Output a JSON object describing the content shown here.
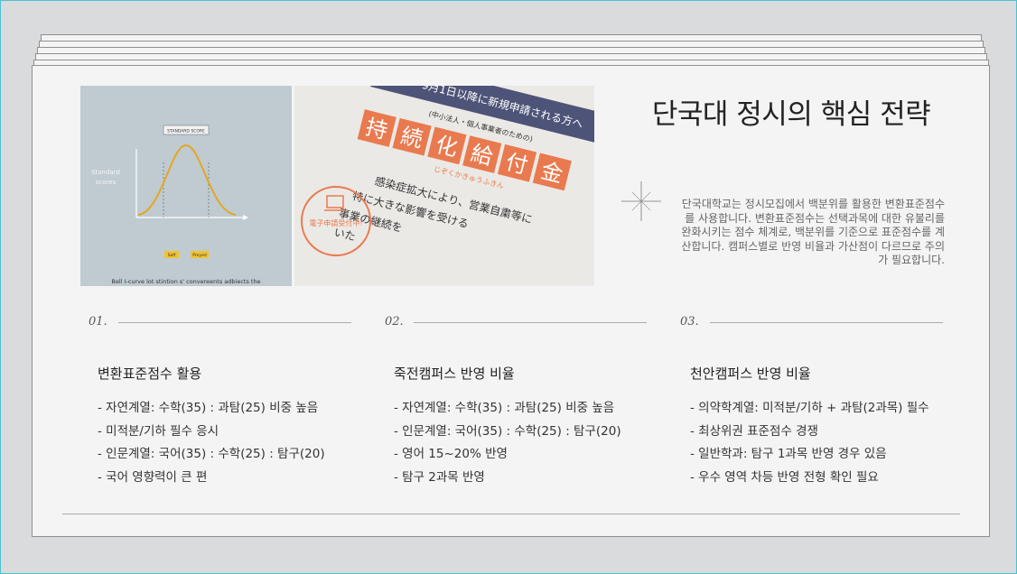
{
  "title": "단국대 정시의 핵심 전략",
  "description": "단국대학교는 정시모집에서 백분위를 활용한 변환표준점수를 사용합니다. 변환표준점수는 선택과목에 대한 유불리를 완화시키는 점수 체계로, 백분위를 기준으로 표준점수를 계산합니다. 캠퍼스별로 반영 비율과 가산점이 다르므로 주의가 필요합니다.",
  "left_image": {
    "chart_label": "STANDARD SCORE",
    "axis_label": "Standard scores",
    "button_a": "Saff",
    "button_b": "Preyed",
    "caption": "Bell I-curve lot stintion s' convereents adbiects the"
  },
  "right_image": {
    "banner": "9月1日以降に新規申請される方へ",
    "sub_banner": "(中小法人・個人事業者のための)",
    "big_text": [
      "持",
      "続",
      "化",
      "給",
      "付",
      "金"
    ],
    "reading": "じぞくかきゅうふきん",
    "stamp_text": "電子申請受付中!",
    "body_lines": [
      "感染症拡大により、営業自粛等に",
      "特に大きな影響を受ける",
      "事業の継続を",
      "いた"
    ]
  },
  "columns": [
    {
      "num": "01.",
      "heading": "변환표준점수 활용",
      "items": [
        "- 자연계열: 수학(35) : 과탐(25) 비중 높음",
        "- 미적분/기하 필수 응시",
        "- 인문계열: 국어(35) : 수학(25) : 탐구(20)",
        "- 국어 영향력이 큰 편"
      ]
    },
    {
      "num": "02.",
      "heading": "죽전캠퍼스 반영 비율",
      "items": [
        "- 자연계열: 수학(35) : 과탐(25) 비중 높음",
        "- 인문계열: 국어(35) : 수학(25) : 탐구(20)",
        "- 영어 15~20% 반영",
        "- 탐구 2과목 반영"
      ]
    },
    {
      "num": "03.",
      "heading": "천안캠퍼스 반영 비율",
      "items": [
        "- 의약학계열: 미적분/기하 + 과탐(2과목) 필수",
        "- 최상위권 표준점수 경쟁",
        "- 일반학과: 탐구 1과목 반영 경우 있음",
        "- 우수 영역 차등 반영 전형 확인 필요"
      ]
    }
  ]
}
